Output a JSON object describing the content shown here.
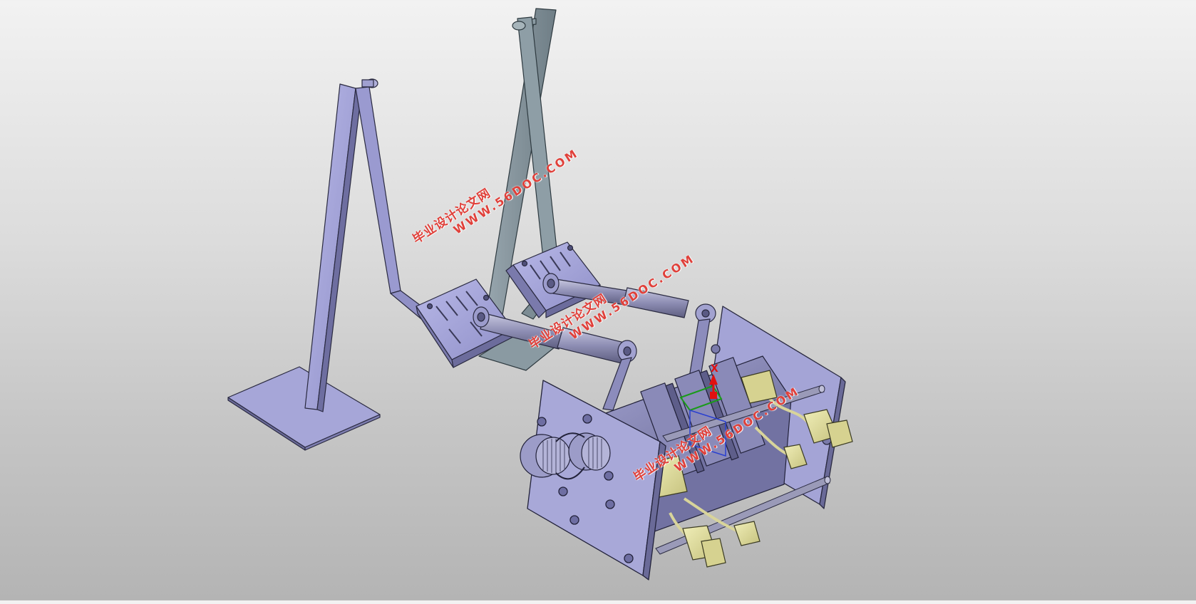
{
  "viewport": {
    "background_top": "#f2f2f2",
    "background_bottom": "#b4b4b4",
    "part_color": "#a4a4d8",
    "frame_color": "#8c9ca4",
    "connector_color": "#e6e2a2"
  },
  "watermarks": [
    {
      "line1": "毕业设计论文网",
      "line2": "WWW.56DOC.COM"
    },
    {
      "line1": "毕业设计论文网",
      "line2": "WWW.56DOC.COM"
    },
    {
      "line1": "毕业设计论文网",
      "line2": "WWW.56DOC.COM"
    }
  ],
  "compass": {
    "axis_label": "X",
    "axis_color": "#e01010"
  }
}
